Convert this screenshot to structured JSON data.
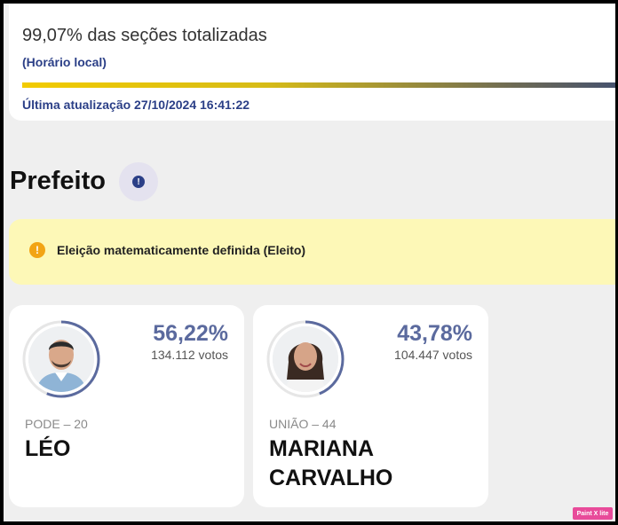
{
  "progress": {
    "title": "99,07% das seções totalizadas",
    "subtitle": "(Horário local)",
    "updated": "Última atualização 27/10/2024 16:41:22",
    "fill_fraction": 0.9907,
    "bar_colors": [
      "#f2cb00",
      "#3e4d73"
    ]
  },
  "section": {
    "title": "Prefeito",
    "info_icon": "info-icon"
  },
  "alert": {
    "icon": "warning-icon",
    "text": "Eleição matematicamente definida (Eleito)",
    "background": "#fdf8b7"
  },
  "candidates": [
    {
      "percent": "56,22%",
      "votes": "134.112 votos",
      "party": "PODE – 20",
      "name": "LÉO",
      "share": 0.5622
    },
    {
      "percent": "43,78%",
      "votes": "104.447 votos",
      "party": "UNIÃO – 44",
      "name": "MARIANA CARVALHO",
      "share": 0.4378
    }
  ],
  "accent": "#5b6a9e",
  "watermark": "Paint X lite"
}
